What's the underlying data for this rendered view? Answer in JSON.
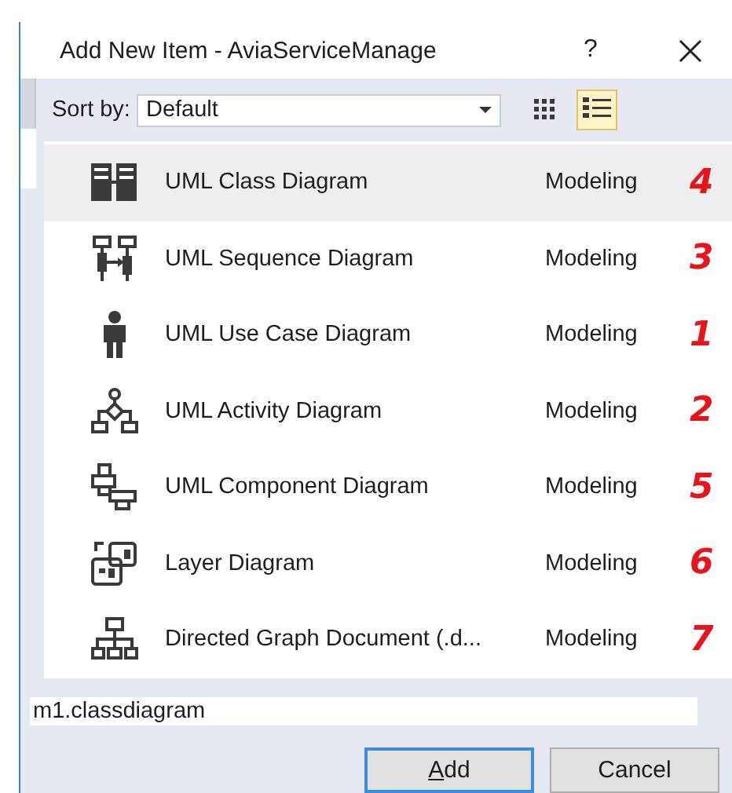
{
  "window": {
    "title": "Add New Item - AviaServiceManage",
    "help": "?"
  },
  "toolbar": {
    "sort_label": "Sort by:",
    "sort_value": "Default",
    "views": [
      {
        "kind": "grid",
        "selected": false
      },
      {
        "kind": "list",
        "selected": true
      }
    ]
  },
  "items": [
    {
      "kind": "class",
      "name": "UML Class Diagram",
      "category": "Modeling",
      "annotation": "4",
      "selected": true
    },
    {
      "kind": "sequence",
      "name": "UML Sequence Diagram",
      "category": "Modeling",
      "annotation": "3",
      "selected": false
    },
    {
      "kind": "usecase",
      "name": "UML Use Case Diagram",
      "category": "Modeling",
      "annotation": "1",
      "selected": false
    },
    {
      "kind": "activity",
      "name": "UML Activity Diagram",
      "category": "Modeling",
      "annotation": "2",
      "selected": false
    },
    {
      "kind": "component",
      "name": "UML Component Diagram",
      "category": "Modeling",
      "annotation": "5",
      "selected": false
    },
    {
      "kind": "layer",
      "name": "Layer Diagram",
      "category": "Modeling",
      "annotation": "6",
      "selected": false
    },
    {
      "kind": "graph",
      "name": "Directed Graph Document (.d...",
      "category": "Modeling",
      "annotation": "7",
      "selected": false
    }
  ],
  "filename": "m1.classdiagram",
  "buttons": [
    {
      "label": "Add",
      "access_key_underlined": true,
      "default": true
    },
    {
      "label": "Cancel",
      "default": false
    }
  ]
}
